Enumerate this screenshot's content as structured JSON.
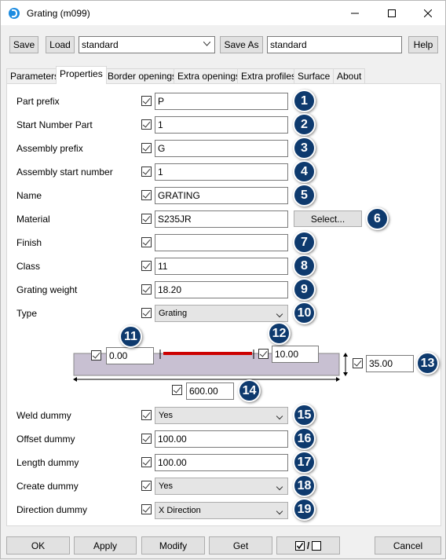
{
  "window": {
    "title": "Grating (m099)"
  },
  "toolbar": {
    "save": "Save",
    "load": "Load",
    "preset": "standard",
    "save_as": "Save As",
    "save_as_name": "standard",
    "help": "Help"
  },
  "tabs": [
    "Parameters",
    "Properties",
    "Border openings",
    "Extra openings",
    "Extra profiles",
    "Surface",
    "About"
  ],
  "properties": [
    {
      "label": "Part prefix",
      "value": "P",
      "badge": "1"
    },
    {
      "label": "Start Number Part",
      "value": "1",
      "badge": "2"
    },
    {
      "label": "Assembly prefix",
      "value": "G",
      "badge": "3"
    },
    {
      "label": "Assembly start number",
      "value": "1",
      "badge": "4"
    },
    {
      "label": "Name",
      "value": "GRATING",
      "badge": "5"
    },
    {
      "label": "Material",
      "value": "S235JR",
      "badge": "6",
      "button": "Select..."
    },
    {
      "label": "Finish",
      "value": "",
      "badge": "7"
    },
    {
      "label": "Class",
      "value": "11",
      "badge": "8"
    },
    {
      "label": "Grating weight",
      "value": "18.20",
      "badge": "9"
    },
    {
      "label": "Type",
      "value": "Grating",
      "badge": "10"
    }
  ],
  "diagram": {
    "left_offset": {
      "value": "0.00",
      "badge": "11"
    },
    "right_offset": {
      "value": "10.00",
      "badge": "12"
    },
    "thickness": {
      "value": "35.00",
      "badge": "13"
    },
    "length": {
      "value": "600.00",
      "badge": "14"
    }
  },
  "dummy": [
    {
      "label": "Weld dummy",
      "value": "Yes",
      "badge": "15",
      "type": "select"
    },
    {
      "label": "Offset dummy",
      "value": "100.00",
      "badge": "16",
      "type": "text"
    },
    {
      "label": "Length dummy",
      "value": "100.00",
      "badge": "17",
      "type": "text"
    },
    {
      "label": "Create dummy",
      "value": "Yes",
      "badge": "18",
      "type": "select"
    },
    {
      "label": "Direction dummy",
      "value": "X Direction",
      "badge": "19",
      "type": "select"
    }
  ],
  "bottom": {
    "ok": "OK",
    "apply": "Apply",
    "modify": "Modify",
    "get": "Get",
    "toggle": "/",
    "cancel": "Cancel"
  },
  "colors": {
    "badge": "#0e3a6e",
    "plate": "#c8c0d2",
    "weld": "#cc0000"
  }
}
